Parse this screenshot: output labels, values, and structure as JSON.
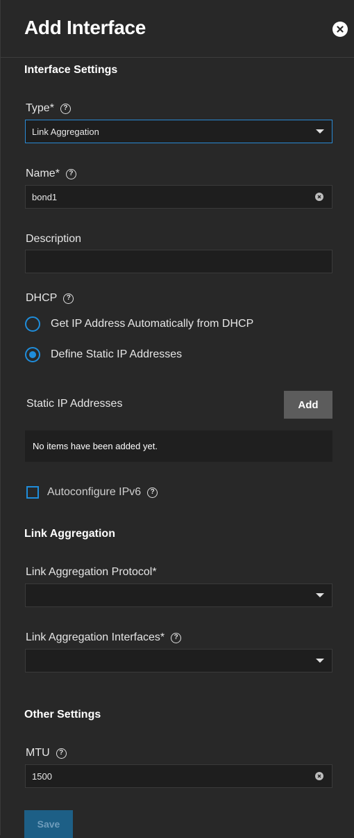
{
  "header": {
    "title": "Add Interface"
  },
  "interface_settings": {
    "section_title": "Interface Settings",
    "type": {
      "label": "Type",
      "required_mark": "*",
      "value": "Link Aggregation"
    },
    "name": {
      "label": "Name",
      "required_mark": "*",
      "value": "bond1"
    },
    "description": {
      "label": "Description",
      "value": ""
    },
    "dhcp": {
      "label": "DHCP",
      "options": [
        {
          "label": "Get IP Address Automatically from DHCP",
          "checked": false
        },
        {
          "label": "Define Static IP Addresses",
          "checked": true
        }
      ]
    },
    "static_ip": {
      "label": "Static IP Addresses",
      "add_label": "Add",
      "empty_text": "No items have been added yet."
    },
    "autoconfigure_ipv6": {
      "label": "Autoconfigure IPv6",
      "checked": false
    }
  },
  "link_aggregation": {
    "section_title": "Link Aggregation",
    "protocol": {
      "label": "Link Aggregation Protocol",
      "required_mark": "*",
      "value": ""
    },
    "interfaces": {
      "label": "Link Aggregation Interfaces",
      "required_mark": "*",
      "value": ""
    }
  },
  "other_settings": {
    "section_title": "Other Settings",
    "mtu": {
      "label": "MTU",
      "value": "1500"
    }
  },
  "footer": {
    "save_label": "Save"
  },
  "colors": {
    "accent": "#1f8ddb",
    "background": "#282828",
    "field": "#1e1e1e",
    "save_disabled": "#1d5f86"
  }
}
